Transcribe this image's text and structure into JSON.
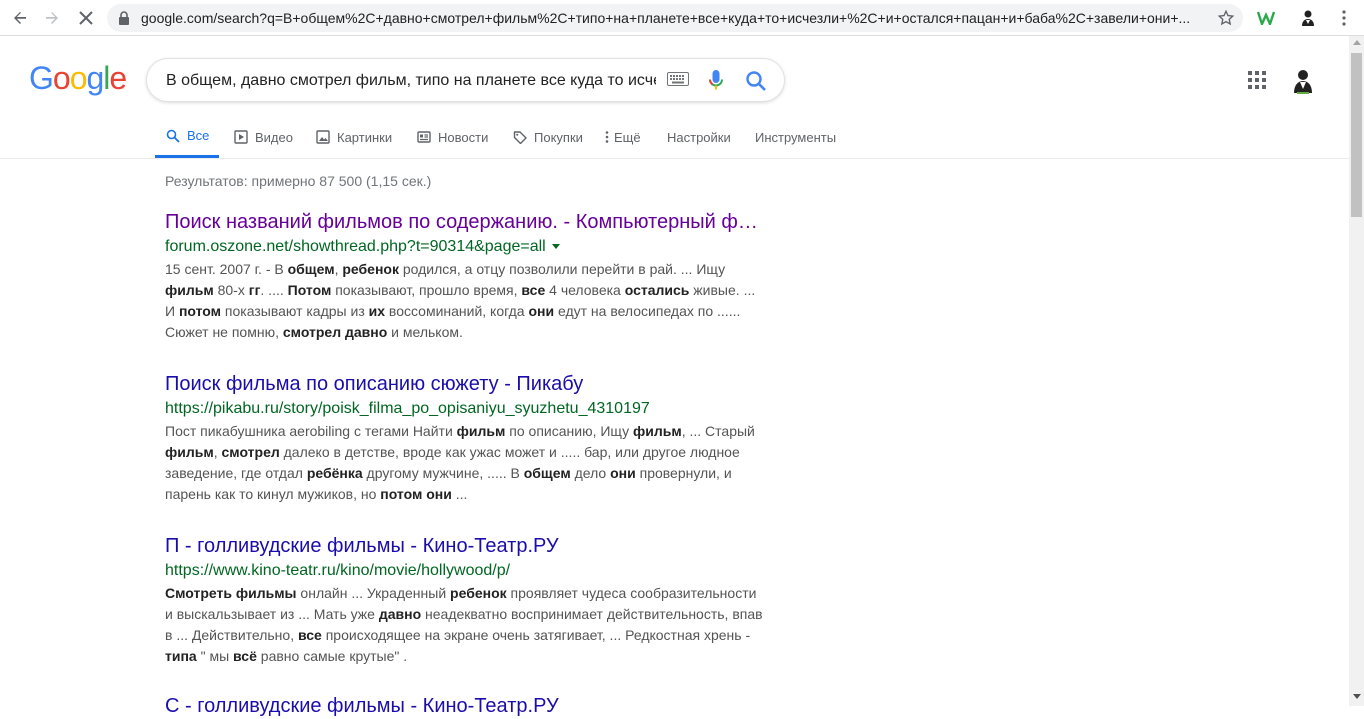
{
  "browser": {
    "url": "google.com/search?q=В+общем%2C+давно+смотрел+фильм%2C+типо+на+планете+все+куда+то+исчезли+%2C+и+остался+пацан+и+баба%2C+завели+они+..."
  },
  "search": {
    "query": "В общем, давно смотрел фильм, типо на планете все куда то исчезли , и остался пацан и баба"
  },
  "logo": [
    "G",
    "o",
    "o",
    "g",
    "l",
    "e"
  ],
  "tabs": {
    "all": "Все",
    "video": "Видео",
    "images": "Картинки",
    "news": "Новости",
    "shopping": "Покупки",
    "more": "Ещё",
    "settings": "Настройки",
    "tools": "Инструменты"
  },
  "stats": "Результатов: примерно 87 500 (1,15 сек.)",
  "results": [
    {
      "title": "Поиск названий фильмов по содержанию. - Компьютерный форум",
      "url": "forum.oszone.net/showthread.php?t=90314&page=all"
    },
    {
      "title": "Поиск фильма по описанию сюжету - Пикабу",
      "url": "https://pikabu.ru/story/poisk_filma_po_opisaniyu_syuzhetu_4310197"
    },
    {
      "title": "П - голливудские фильмы - Кино-Театр.РУ",
      "url": "https://www.kino-teatr.ru/kino/movie/hollywood/p/"
    },
    {
      "title": "С - голливудские фильмы - Кино-Театр.РУ"
    }
  ],
  "snippet_segments": {
    "r0": [
      [
        "15 сент. 2007 г. - В ",
        0
      ],
      [
        "общем",
        1
      ],
      [
        ", ",
        0
      ],
      [
        "ребенок",
        1
      ],
      [
        " родился, а отцу позволили перейти в рай. ... Ищу ",
        0
      ],
      [
        "фильм",
        1
      ],
      [
        " 80-х ",
        0
      ],
      [
        "гг",
        1
      ],
      [
        ". .... ",
        0
      ],
      [
        "Потом",
        1
      ],
      [
        " показывают, прошло время, ",
        0
      ],
      [
        "все",
        1
      ],
      [
        " 4 человека ",
        0
      ],
      [
        "остались",
        1
      ],
      [
        " живые. ... И ",
        0
      ],
      [
        "потом",
        1
      ],
      [
        " показывают кадры из ",
        0
      ],
      [
        "их",
        1
      ],
      [
        " воссоминаний, когда ",
        0
      ],
      [
        "они",
        1
      ],
      [
        " едут на велосипедах по ...... Сюжет не помню, ",
        0
      ],
      [
        "смотрел давно",
        1
      ],
      [
        " и мельком.",
        0
      ]
    ],
    "r1": [
      [
        "Пост пикабушника aerobiling с тегами Найти ",
        0
      ],
      [
        "фильм",
        1
      ],
      [
        " по описанию, Ищу ",
        0
      ],
      [
        "фильм",
        1
      ],
      [
        ", ... Старый ",
        0
      ],
      [
        "фильм",
        1
      ],
      [
        ", ",
        0
      ],
      [
        "смотрел",
        1
      ],
      [
        " далеко в детстве, вроде как ужас может и ..... бар, или другое людное заведение, где отдал ",
        0
      ],
      [
        "ребёнка",
        1
      ],
      [
        " другому мужчине, ..... В ",
        0
      ],
      [
        "общем",
        1
      ],
      [
        " дело ",
        0
      ],
      [
        "они",
        1
      ],
      [
        " провернули, и парень как то кинул мужиков, но ",
        0
      ],
      [
        "потом они",
        1
      ],
      [
        " ...",
        0
      ]
    ],
    "r2": [
      [
        "Смотреть фильмы",
        1
      ],
      [
        " онлайн ... Украденный ",
        0
      ],
      [
        "ребенок",
        1
      ],
      [
        " проявляет чудеса сообразительности и выскальзывает из ... Мать уже ",
        0
      ],
      [
        "давно",
        1
      ],
      [
        " неадекватно воспринимает действительность, впав в ... Действительно, ",
        0
      ],
      [
        "все",
        1
      ],
      [
        " происходящее на экране очень затягивает, ... Редкостная хрень - ",
        0
      ],
      [
        "типа",
        1
      ],
      [
        " \" мы ",
        0
      ],
      [
        "всё",
        1
      ],
      [
        " равно самые крутые\" .",
        0
      ]
    ]
  },
  "colors": {
    "link_visited": "#660099",
    "link": "#1a0dab",
    "url_green": "#006621",
    "active_tab": "#1a73e8"
  }
}
